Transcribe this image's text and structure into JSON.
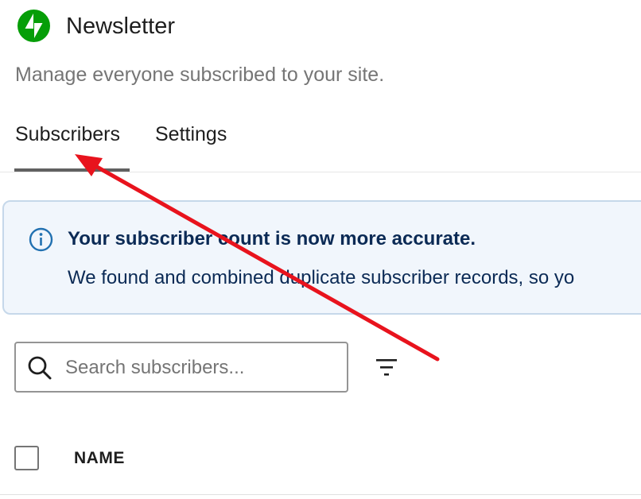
{
  "header": {
    "logo_icon": "jetpack-logo-icon",
    "title": "Newsletter",
    "subtitle": "Manage everyone subscribed to your site."
  },
  "tabs": [
    {
      "label": "Subscribers",
      "active": true
    },
    {
      "label": "Settings",
      "active": false
    }
  ],
  "notice": {
    "icon": "info-icon",
    "title": "Your subscriber count is now more accurate.",
    "body": "We found and combined duplicate subscriber records, so yo"
  },
  "search": {
    "icon": "search-icon",
    "placeholder": "Search subscribers...",
    "value": ""
  },
  "filter": {
    "icon": "filter-icon"
  },
  "table": {
    "columns": [
      "NAME"
    ]
  },
  "colors": {
    "brand": "#069e08",
    "notice_bg": "#f1f6fc",
    "notice_border": "#c6d8ea",
    "notice_text": "#0b2a55",
    "annotation_arrow": "#e8131d"
  }
}
